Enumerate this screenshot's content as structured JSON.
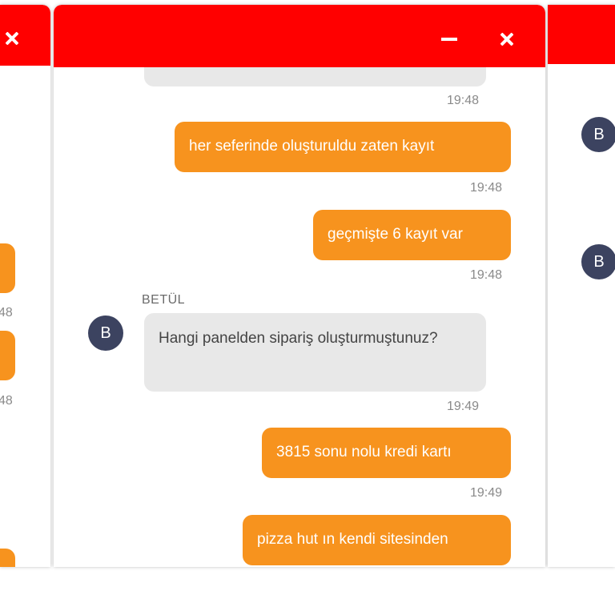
{
  "colors": {
    "titlebar": "#ff0000",
    "outgoing_bubble": "#f7931e",
    "incoming_bubble": "#e8e8e8",
    "avatar": "#3c4360"
  },
  "left_window": {
    "timestamps": [
      "48",
      "48"
    ]
  },
  "main_window": {
    "messages": [
      {
        "direction": "in",
        "text": "",
        "time": "19:48"
      },
      {
        "direction": "out",
        "text": "her seferinde oluşturuldu zaten kayıt",
        "time": "19:48"
      },
      {
        "direction": "out",
        "text": "geçmişte 6 kayıt var",
        "time": "19:48"
      },
      {
        "direction": "in",
        "sender": "BETÜL",
        "avatar": "B",
        "text": "Hangi panelden sipariş oluşturmuştunuz?",
        "time": "19:49"
      },
      {
        "direction": "out",
        "text": "3815 sonu nolu kredi kartı",
        "time": "19:49"
      },
      {
        "direction": "out",
        "text": "pizza hut ın kendi sitesinden",
        "time": ""
      }
    ]
  },
  "right_window": {
    "avatars": [
      "B",
      "B"
    ]
  }
}
